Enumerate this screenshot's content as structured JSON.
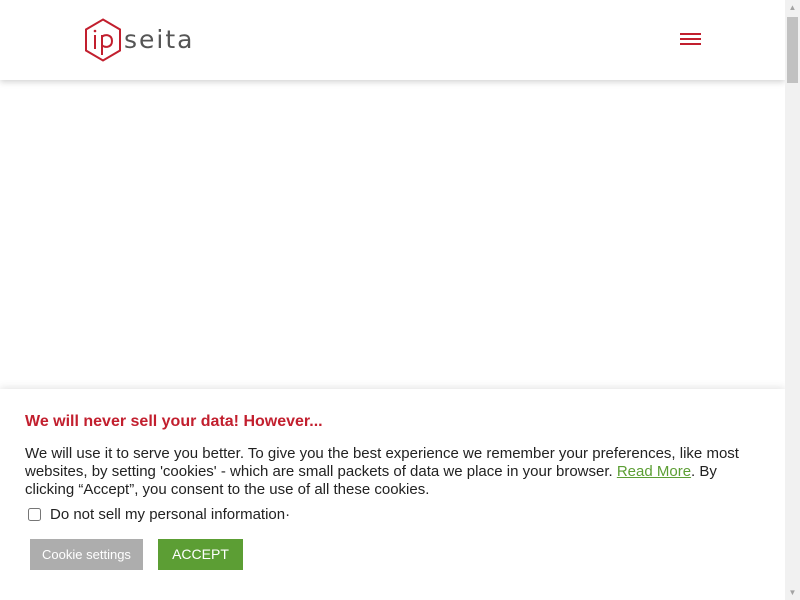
{
  "header": {
    "logo": {
      "text": "seita",
      "mark_text": "ip",
      "mark_color": "#c21f2e"
    },
    "menu_icon": "hamburger-menu-icon",
    "accent_color": "#c21f2e"
  },
  "cookie_banner": {
    "title": "We will never sell your data! However...",
    "text_before_link": "We will use it to serve you better. To give you the best experience we remember your preferences, like most websites, by setting 'cookies' - which are small packets of data we place in your browser. ",
    "read_more_label": "Read More",
    "text_after_link": ". By clicking “Accept”, you consent to the use of all these cookies.",
    "do_not_sell_label": "Do not sell my personal information·",
    "do_not_sell_checked": false,
    "settings_button_label": "Cookie settings",
    "accept_button_label": "ACCEPT",
    "title_color": "#c21f2e",
    "link_color": "#5c9e34",
    "accept_color": "#5c9e34",
    "settings_color": "#adadad"
  },
  "scrollbar": {
    "up_icon": "scroll-up-arrow-icon",
    "down_icon": "scroll-down-arrow-icon"
  }
}
